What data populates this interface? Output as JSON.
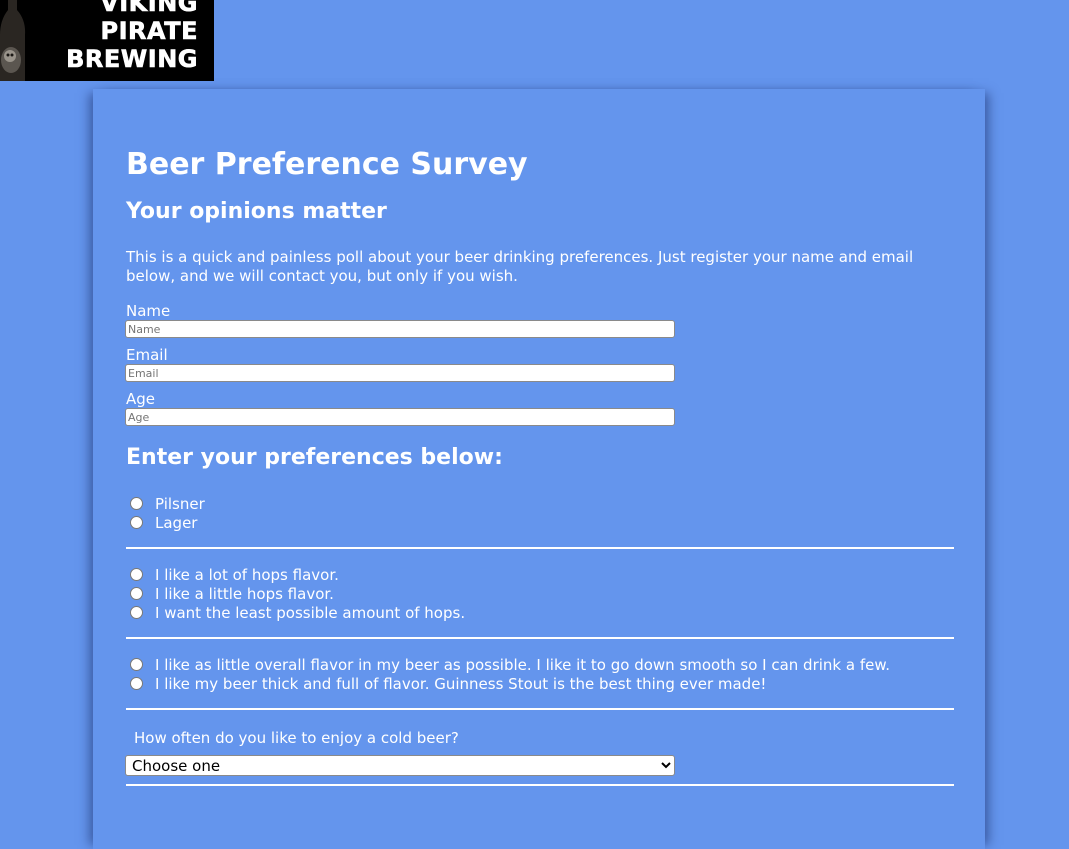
{
  "logo": {
    "lines": [
      "VIKING",
      "PIRATE",
      "BREWING"
    ]
  },
  "survey": {
    "title": "Beer Preference Survey",
    "subtitle": "Your opinions matter",
    "intro": "This is a quick and painless poll about your beer drinking preferences. Just register your name and email below, and we will contact you, but only if you wish.",
    "fields": {
      "name": {
        "label": "Name",
        "placeholder": "Name"
      },
      "email": {
        "label": "Email",
        "placeholder": "Email"
      },
      "age": {
        "label": "Age",
        "placeholder": "Age"
      }
    },
    "preferences_heading": "Enter your preferences below:",
    "beer_type": [
      "Pilsner",
      "Lager"
    ],
    "hops": [
      "I like a lot of hops flavor.",
      "I like a little hops flavor.",
      "I want the least possible amount of hops."
    ],
    "body": [
      "I like as little overall flavor in my beer as possible. I like it to go down smooth so I can drink a few.",
      "I like my beer thick and full of flavor. Guinness Stout is the best thing ever made!"
    ],
    "frequency": {
      "question": "How often do you like to enjoy a cold beer?",
      "selected": "Choose one"
    }
  },
  "colors": {
    "background": "#6495ed",
    "text": "#ffffff"
  }
}
